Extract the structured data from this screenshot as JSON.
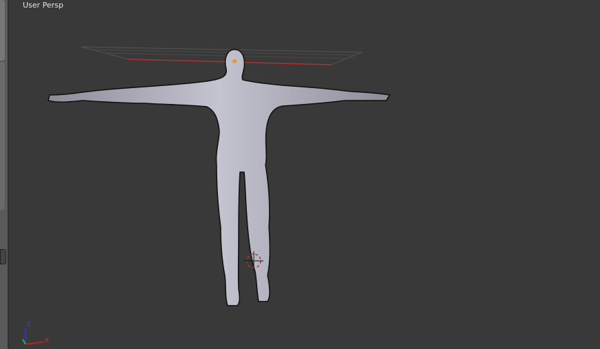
{
  "viewport": {
    "view_label": "User Persp",
    "axes": {
      "x": "X",
      "z": "Z"
    }
  },
  "colors": {
    "background": "#393939",
    "mesh": "#a9a9b6",
    "x_axis": "#c02020",
    "y_axis": "#20c020",
    "z_axis": "#3030d0"
  }
}
